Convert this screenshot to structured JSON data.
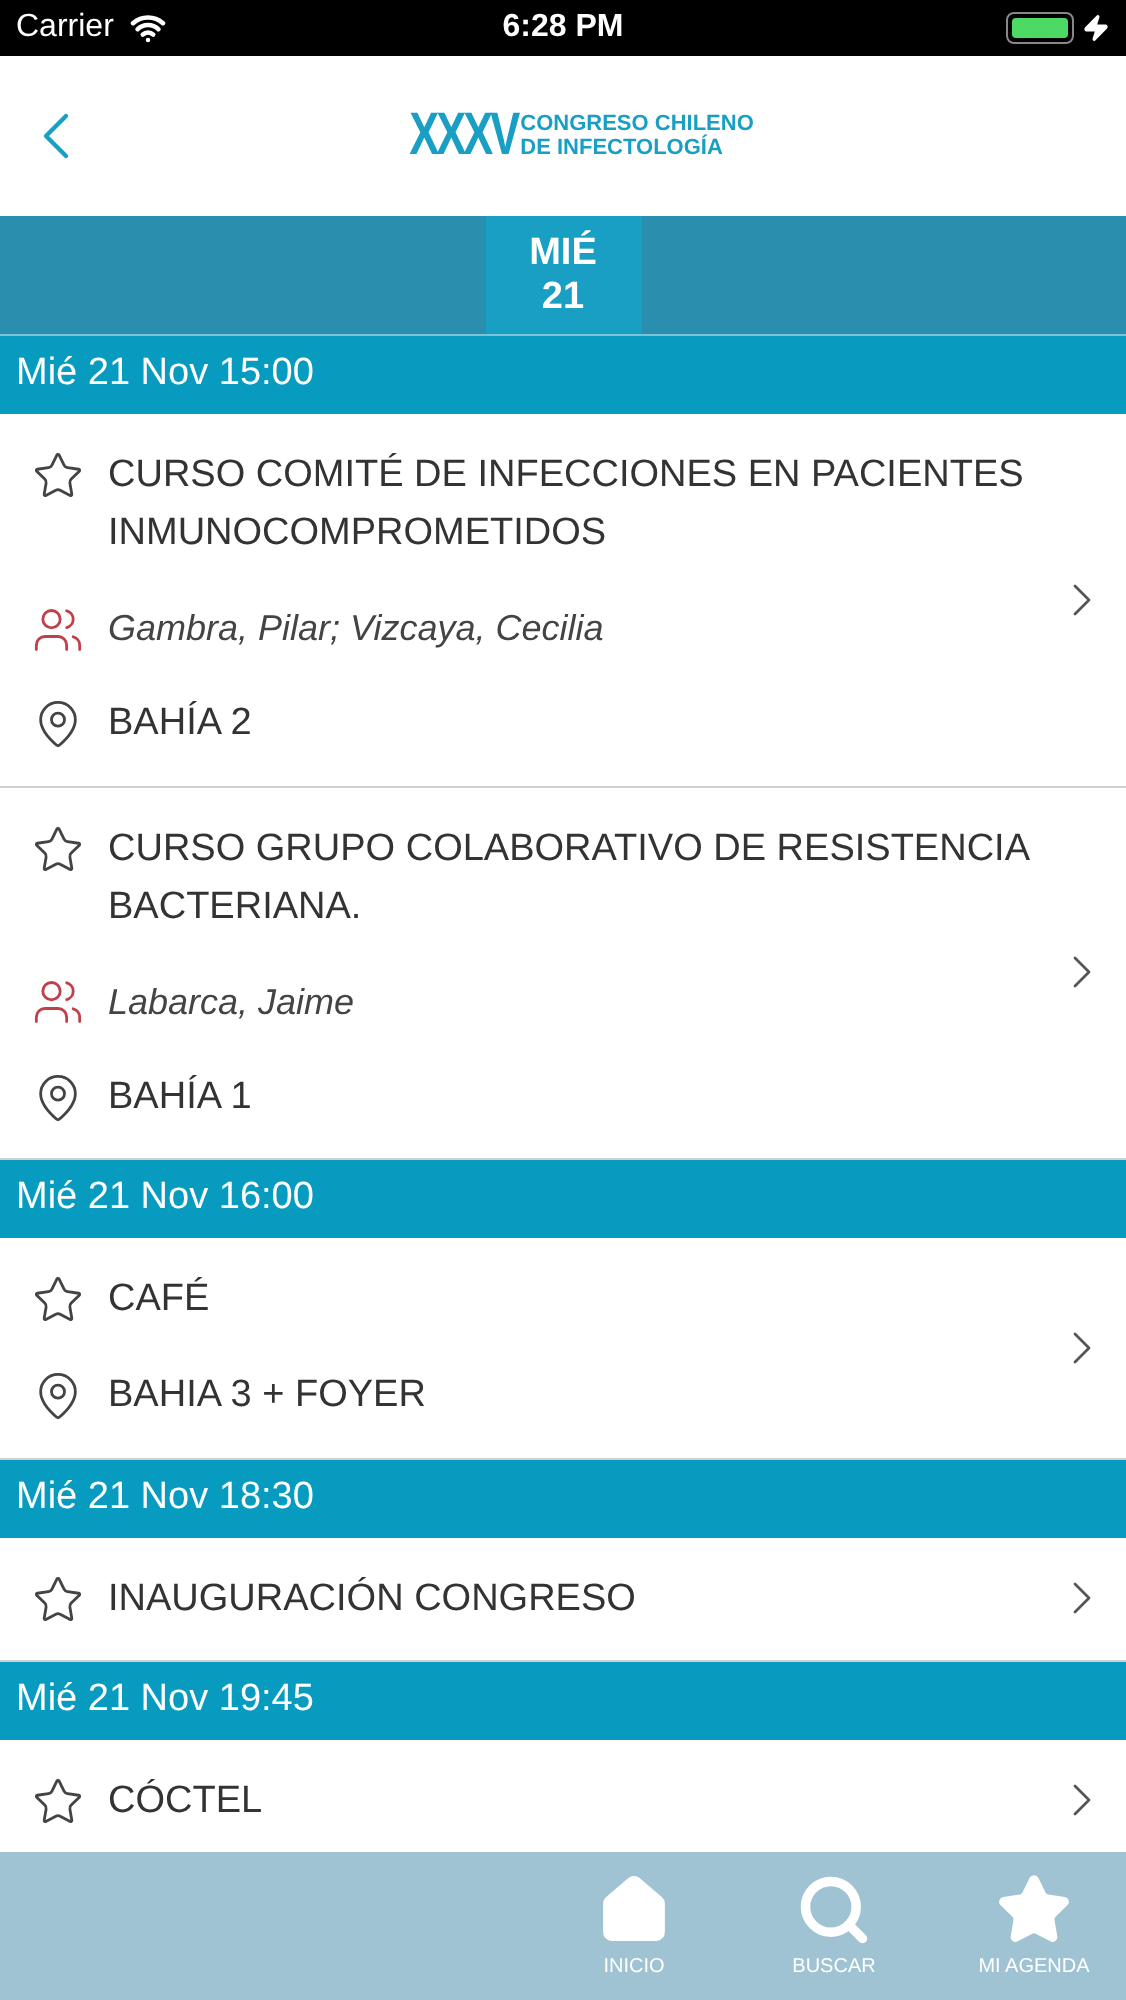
{
  "status_bar": {
    "carrier": "Carrier",
    "time": "6:28 PM"
  },
  "header": {
    "logo_numeral": "XXXV",
    "logo_lines": [
      "CONGRESO CHILENO",
      "DE INFECTOLOGÍA"
    ]
  },
  "day_tabs": [
    {
      "weekday": "MIÉ",
      "day": "21",
      "selected": true
    }
  ],
  "sections": [
    {
      "heading": "Mié 21 Nov 15:00",
      "events": [
        {
          "title": "CURSO COMITÉ DE INFECCIONES EN PACIENTES INMUNOCOMPROMETIDOS",
          "speakers": "Gambra, Pilar; Vizcaya, Cecilia",
          "location": "BAHÍA 2",
          "starred": false
        },
        {
          "title": "CURSO GRUPO COLABORATIVO DE RESISTENCIA BACTERIANA.",
          "speakers": "Labarca, Jaime",
          "location": "BAHÍA 1",
          "starred": false
        }
      ]
    },
    {
      "heading": "Mié 21 Nov 16:00",
      "events": [
        {
          "title": "CAFÉ",
          "location": "BAHIA 3 + FOYER",
          "starred": false
        }
      ]
    },
    {
      "heading": "Mié 21 Nov 18:30",
      "events": [
        {
          "title": "INAUGURACIÓN CONGRESO",
          "starred": false
        }
      ]
    },
    {
      "heading": "Mié 21 Nov 19:45",
      "events": [
        {
          "title": "CÓCTEL",
          "starred": false
        }
      ]
    }
  ],
  "tab_bar": [
    {
      "kind": "home",
      "label": "INICIO"
    },
    {
      "kind": "search",
      "label": "BUSCAR"
    },
    {
      "kind": "star",
      "label": "MI AGENDA"
    }
  ]
}
